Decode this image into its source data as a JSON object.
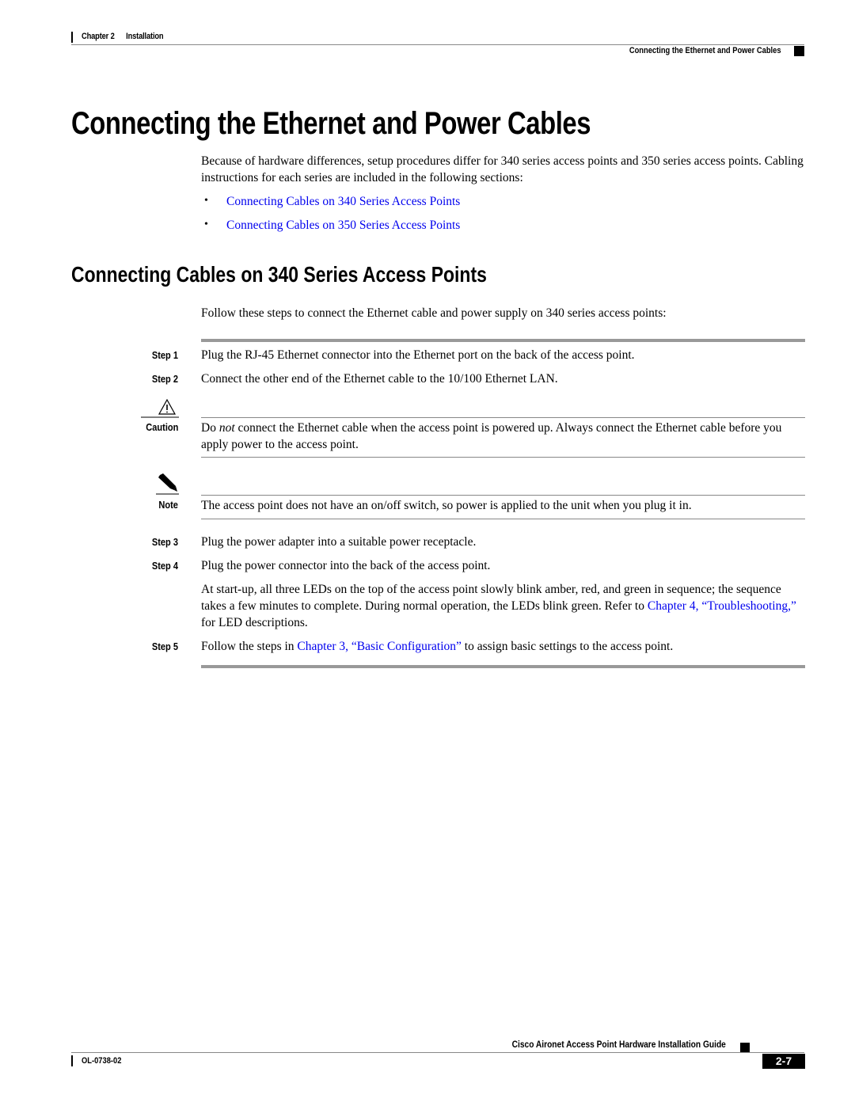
{
  "header": {
    "chapter": "Chapter 2      Installation",
    "section": "Connecting the Ethernet and Power Cables"
  },
  "title": "Connecting the Ethernet and Power Cables",
  "intro": "Because of hardware differences, setup procedures differ for 340 series access points and 350 series access points. Cabling instructions for each series are included in the following sections:",
  "links": [
    "Connecting Cables on 340 Series Access Points",
    "Connecting Cables on 350 Series Access Points"
  ],
  "section": {
    "title": "Connecting Cables on 340 Series Access Points",
    "intro": "Follow these steps to connect the Ethernet cable and power supply on 340 series access points:",
    "steps": [
      {
        "label": "Step 1",
        "text": "Plug the RJ-45 Ethernet connector into the Ethernet port on the back of the access point."
      },
      {
        "label": "Step 2",
        "text": "Connect the other end of the Ethernet cable to the 10/100 Ethernet LAN."
      },
      {
        "label": "Step 3",
        "text": "Plug the power adapter into a suitable power receptacle."
      },
      {
        "label": "Step 4",
        "text": "Plug the power connector into the back of the access point."
      }
    ],
    "caution": {
      "label": "Caution",
      "pre": "Do ",
      "em": "not",
      "post": " connect the Ethernet cable when the access point is powered up. Always connect the Ethernet cable before you apply power to the access point."
    },
    "note": {
      "label": "Note",
      "text": "The access point does not have an on/off switch, so power is applied to the unit when you plug it in."
    },
    "step4_detail": {
      "text": "At start-up, all three LEDs on the top of the access point slowly blink amber, red, and green in sequence; the sequence takes a few minutes to complete. During normal operation, the LEDs blink green. Refer to ",
      "link": "Chapter 4, “Troubleshooting,”",
      "post": " for LED descriptions."
    },
    "step5": {
      "label": "Step 5",
      "pre": "Follow the steps in ",
      "link": "Chapter 3, “Basic Configuration”",
      "post": " to assign basic settings to the access point."
    }
  },
  "footer": {
    "guide_title": "Cisco Aironet Access Point Hardware Installation Guide",
    "doc_number": "OL-0738-02",
    "page": "2-7"
  }
}
